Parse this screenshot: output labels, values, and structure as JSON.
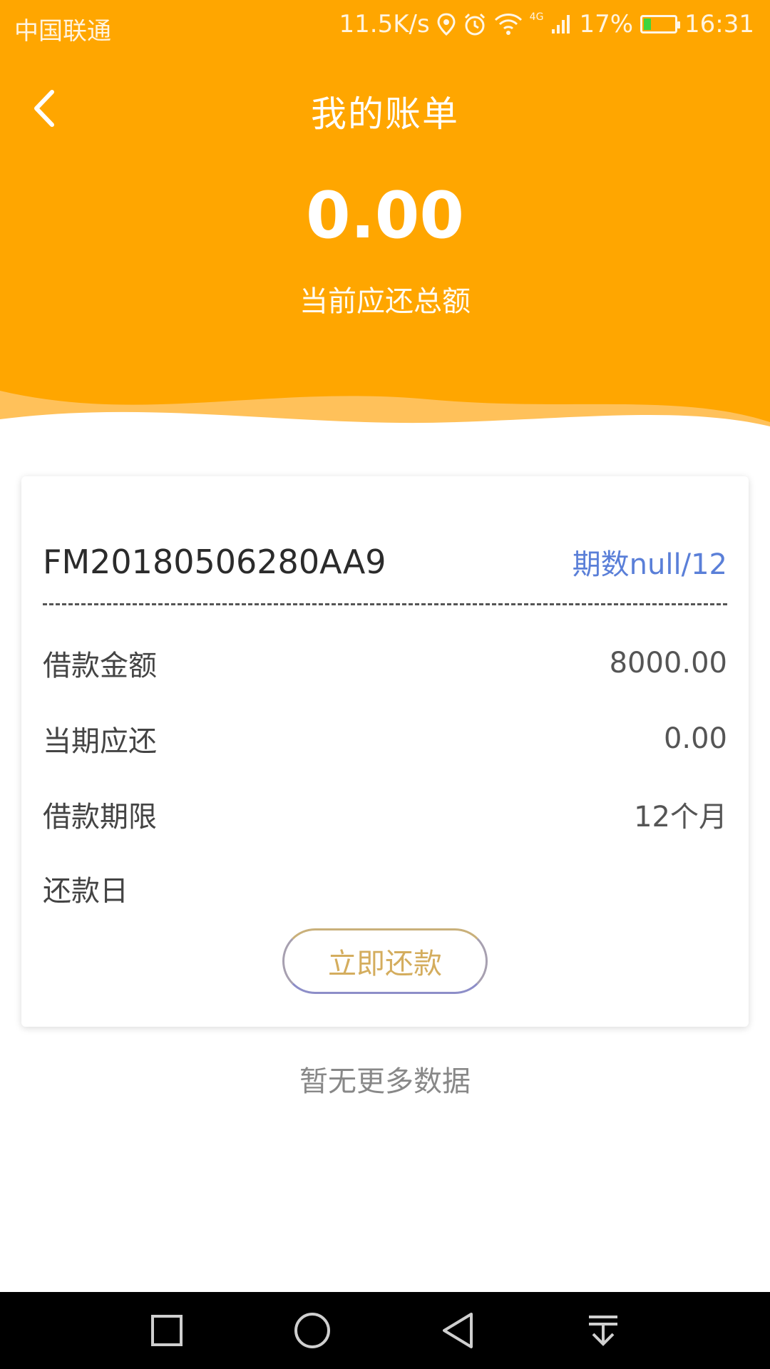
{
  "status_bar": {
    "carrier": "中国联通",
    "speed": "11.5K/s",
    "network": "4G",
    "battery": "17%",
    "time": "16:31"
  },
  "header": {
    "title": "我的账单",
    "total_amount": "0.00",
    "total_label": "当前应还总额",
    "bg_color": "#FFA600"
  },
  "bill": {
    "loan_id": "FM20180506280AA9",
    "period": "期数null/12",
    "rows": [
      {
        "label": "借款金额",
        "value": "8000.00"
      },
      {
        "label": "当期应还",
        "value": "0.00"
      },
      {
        "label": "借款期限",
        "value": "12个月"
      },
      {
        "label": "还款日",
        "value": ""
      }
    ],
    "pay_button": "立即还款"
  },
  "footer": {
    "no_more": "暂无更多数据"
  },
  "nav": {
    "icons": [
      "recent-apps-icon",
      "home-icon",
      "back-icon",
      "notification-pull-icon"
    ]
  }
}
